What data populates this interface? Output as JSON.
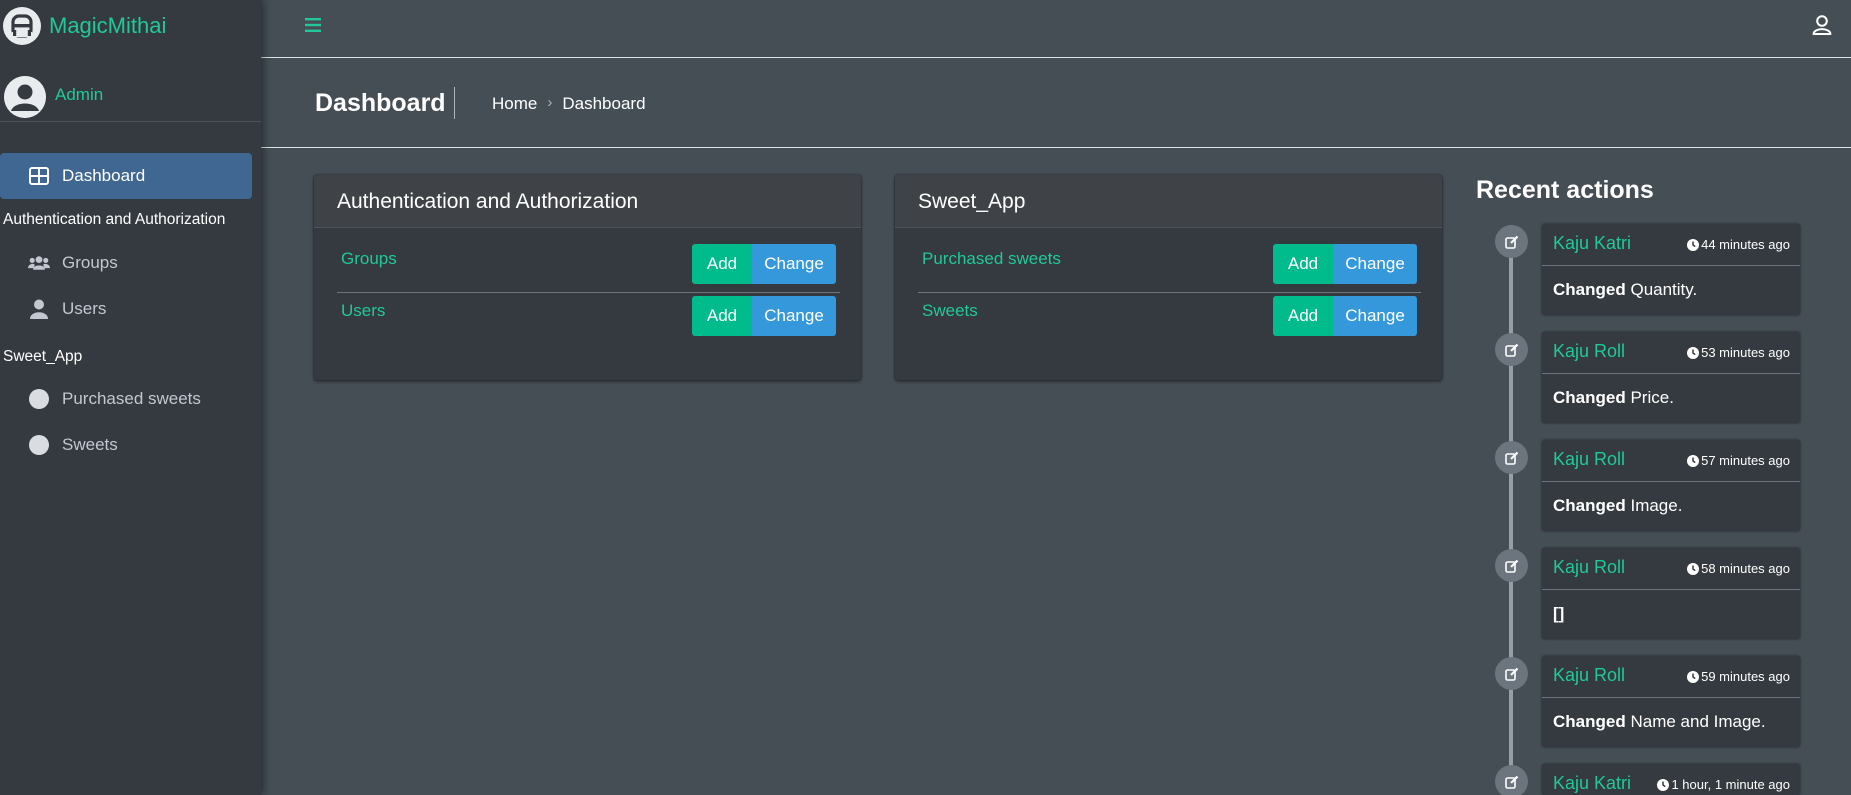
{
  "brand": {
    "name": "MagicMithai"
  },
  "user": {
    "name": "Admin"
  },
  "sidebar": {
    "items": [
      {
        "label": "Dashboard",
        "icon": "dashboard-icon",
        "active": true
      },
      {
        "header": "Authentication and Authorization"
      },
      {
        "label": "Groups",
        "icon": "users-group-icon"
      },
      {
        "label": "Users",
        "icon": "user-icon"
      },
      {
        "header": "Sweet_App"
      },
      {
        "label": "Purchased sweets",
        "icon": "circle-icon"
      },
      {
        "label": "Sweets",
        "icon": "circle-icon"
      }
    ]
  },
  "content_header": {
    "title": "Dashboard",
    "breadcrumb": [
      "Home",
      "›",
      "Dashboard"
    ]
  },
  "apps": [
    {
      "title": "Authentication and Authorization",
      "models": [
        {
          "name": "Groups",
          "add_label": "Add",
          "change_label": "Change"
        },
        {
          "name": "Users",
          "add_label": "Add",
          "change_label": "Change"
        }
      ]
    },
    {
      "title": "Sweet_App",
      "models": [
        {
          "name": "Purchased sweets",
          "add_label": "Add",
          "change_label": "Change"
        },
        {
          "name": "Sweets",
          "add_label": "Add",
          "change_label": "Change"
        }
      ]
    }
  ],
  "recent_actions": {
    "title": "Recent actions",
    "items": [
      {
        "object": "Kaju Katri",
        "time": "44 minutes ago",
        "action": "Changed",
        "detail": "Quantity."
      },
      {
        "object": "Kaju Roll",
        "time": "53 minutes ago",
        "action": "Changed",
        "detail": "Price."
      },
      {
        "object": "Kaju Roll",
        "time": "57 minutes ago",
        "action": "Changed",
        "detail": "Image."
      },
      {
        "object": "Kaju Roll",
        "time": "58 minutes ago",
        "action": "",
        "detail": "[]"
      },
      {
        "object": "Kaju Roll",
        "time": "59 minutes ago",
        "action": "Changed",
        "detail": "Name and Image."
      },
      {
        "object": "Kaju Katri",
        "time": "1 hour, 1 minute ago",
        "action": "",
        "detail": ""
      }
    ]
  },
  "colors": {
    "accent": "#20c997",
    "btn_add": "#00bc8c",
    "btn_change": "#3498db",
    "active_nav": "#3f6791",
    "sidebar_bg": "#343a40",
    "page_bg": "#454d55"
  }
}
